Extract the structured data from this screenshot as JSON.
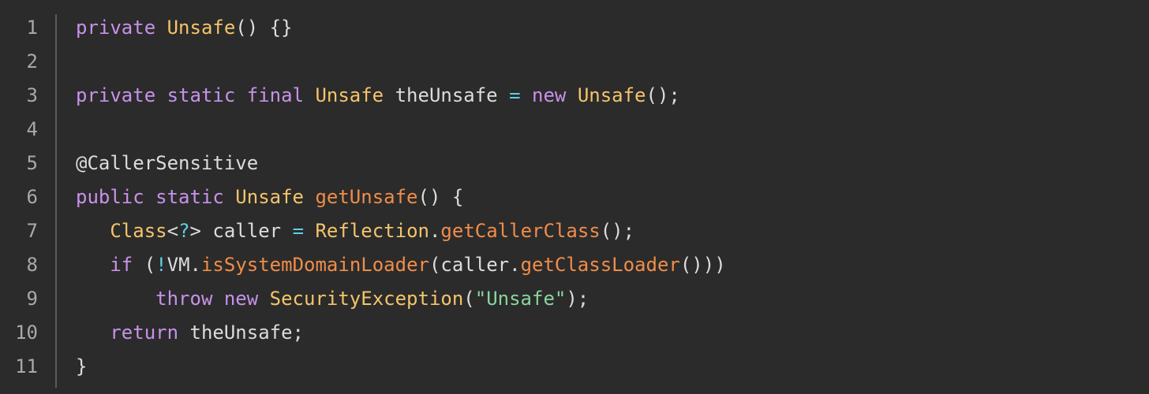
{
  "editor": {
    "language": "java",
    "line_numbers": [
      "1",
      "2",
      "3",
      "4",
      "5",
      "6",
      "7",
      "8",
      "9",
      "10",
      "11"
    ],
    "lines": [
      [
        {
          "t": "private ",
          "c": "kw"
        },
        {
          "t": "Unsafe",
          "c": "type"
        },
        {
          "t": "() {}",
          "c": "plain"
        }
      ],
      [],
      [
        {
          "t": "private static final ",
          "c": "kw"
        },
        {
          "t": "Unsafe",
          "c": "type"
        },
        {
          "t": " theUnsafe ",
          "c": "plain"
        },
        {
          "t": "=",
          "c": "op"
        },
        {
          "t": " ",
          "c": "plain"
        },
        {
          "t": "new",
          "c": "kw"
        },
        {
          "t": " ",
          "c": "plain"
        },
        {
          "t": "Unsafe",
          "c": "type"
        },
        {
          "t": "();",
          "c": "plain"
        }
      ],
      [],
      [
        {
          "t": "@CallerSensitive",
          "c": "ann"
        }
      ],
      [
        {
          "t": "public static ",
          "c": "kw"
        },
        {
          "t": "Unsafe",
          "c": "type"
        },
        {
          "t": " ",
          "c": "plain"
        },
        {
          "t": "getUnsafe",
          "c": "fn"
        },
        {
          "t": "() {",
          "c": "plain"
        }
      ],
      [
        {
          "t": "   ",
          "c": "plain"
        },
        {
          "t": "Class",
          "c": "type"
        },
        {
          "t": "<",
          "c": "plain"
        },
        {
          "t": "?",
          "c": "op"
        },
        {
          "t": "> caller ",
          "c": "plain"
        },
        {
          "t": "=",
          "c": "op"
        },
        {
          "t": " ",
          "c": "plain"
        },
        {
          "t": "Reflection",
          "c": "type"
        },
        {
          "t": ".",
          "c": "plain"
        },
        {
          "t": "getCallerClass",
          "c": "fn"
        },
        {
          "t": "();",
          "c": "plain"
        }
      ],
      [
        {
          "t": "   ",
          "c": "plain"
        },
        {
          "t": "if",
          "c": "kw"
        },
        {
          "t": " (",
          "c": "plain"
        },
        {
          "t": "!",
          "c": "op"
        },
        {
          "t": "VM.",
          "c": "plain"
        },
        {
          "t": "isSystemDomainLoader",
          "c": "fn"
        },
        {
          "t": "(caller.",
          "c": "plain"
        },
        {
          "t": "getClassLoader",
          "c": "fn"
        },
        {
          "t": "()))",
          "c": "plain"
        }
      ],
      [
        {
          "t": "       ",
          "c": "plain"
        },
        {
          "t": "throw new",
          "c": "kw"
        },
        {
          "t": " ",
          "c": "plain"
        },
        {
          "t": "SecurityException",
          "c": "type"
        },
        {
          "t": "(",
          "c": "plain"
        },
        {
          "t": "\"Unsafe\"",
          "c": "str"
        },
        {
          "t": ");",
          "c": "plain"
        }
      ],
      [
        {
          "t": "   ",
          "c": "plain"
        },
        {
          "t": "return",
          "c": "kw"
        },
        {
          "t": " theUnsafe;",
          "c": "plain"
        }
      ],
      [
        {
          "t": "}",
          "c": "plain"
        }
      ]
    ]
  },
  "colors": {
    "background": "#2b2b2b",
    "keyword": "#c792ea",
    "type": "#f5c46a",
    "function": "#f08d49",
    "operator": "#5ccfe6",
    "string": "#8bd49c",
    "plain": "#dcdcdc",
    "line_number": "#a9a9a9"
  }
}
